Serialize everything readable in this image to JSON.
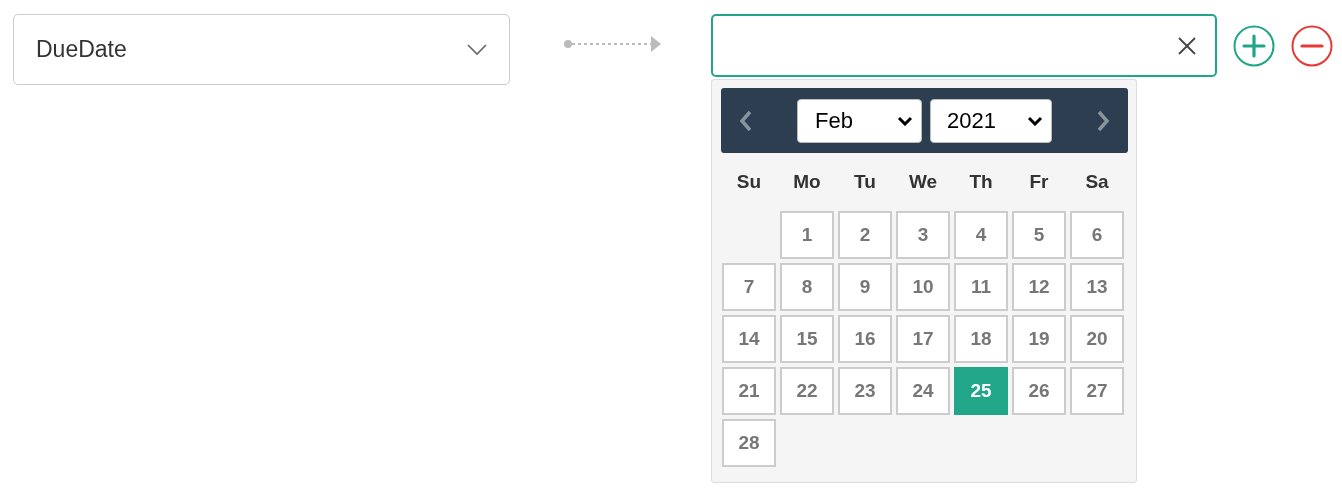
{
  "field_select": {
    "value": "DueDate"
  },
  "datepicker": {
    "month": "Feb",
    "year": "2021",
    "weekdays": [
      "Su",
      "Mo",
      "Tu",
      "We",
      "Th",
      "Fr",
      "Sa"
    ],
    "weeks": [
      [
        {
          "kind": "blank"
        },
        {
          "kind": "day",
          "day": "1",
          "selected": false
        },
        {
          "kind": "day",
          "day": "2",
          "selected": false
        },
        {
          "kind": "day",
          "day": "3",
          "selected": false
        },
        {
          "kind": "day",
          "day": "4",
          "selected": false
        },
        {
          "kind": "day",
          "day": "5",
          "selected": false
        },
        {
          "kind": "day",
          "day": "6",
          "selected": false
        }
      ],
      [
        {
          "kind": "day",
          "day": "7",
          "selected": false
        },
        {
          "kind": "day",
          "day": "8",
          "selected": false
        },
        {
          "kind": "day",
          "day": "9",
          "selected": false
        },
        {
          "kind": "day",
          "day": "10",
          "selected": false
        },
        {
          "kind": "day",
          "day": "11",
          "selected": false
        },
        {
          "kind": "day",
          "day": "12",
          "selected": false
        },
        {
          "kind": "day",
          "day": "13",
          "selected": false
        }
      ],
      [
        {
          "kind": "day",
          "day": "14",
          "selected": false
        },
        {
          "kind": "day",
          "day": "15",
          "selected": false
        },
        {
          "kind": "day",
          "day": "16",
          "selected": false
        },
        {
          "kind": "day",
          "day": "17",
          "selected": false
        },
        {
          "kind": "day",
          "day": "18",
          "selected": false
        },
        {
          "kind": "day",
          "day": "19",
          "selected": false
        },
        {
          "kind": "day",
          "day": "20",
          "selected": false
        }
      ],
      [
        {
          "kind": "day",
          "day": "21",
          "selected": false
        },
        {
          "kind": "day",
          "day": "22",
          "selected": false
        },
        {
          "kind": "day",
          "day": "23",
          "selected": false
        },
        {
          "kind": "day",
          "day": "24",
          "selected": false
        },
        {
          "kind": "day",
          "day": "25",
          "selected": true
        },
        {
          "kind": "day",
          "day": "26",
          "selected": false
        },
        {
          "kind": "day",
          "day": "27",
          "selected": false
        }
      ],
      [
        {
          "kind": "day",
          "day": "28",
          "selected": false
        }
      ]
    ]
  }
}
